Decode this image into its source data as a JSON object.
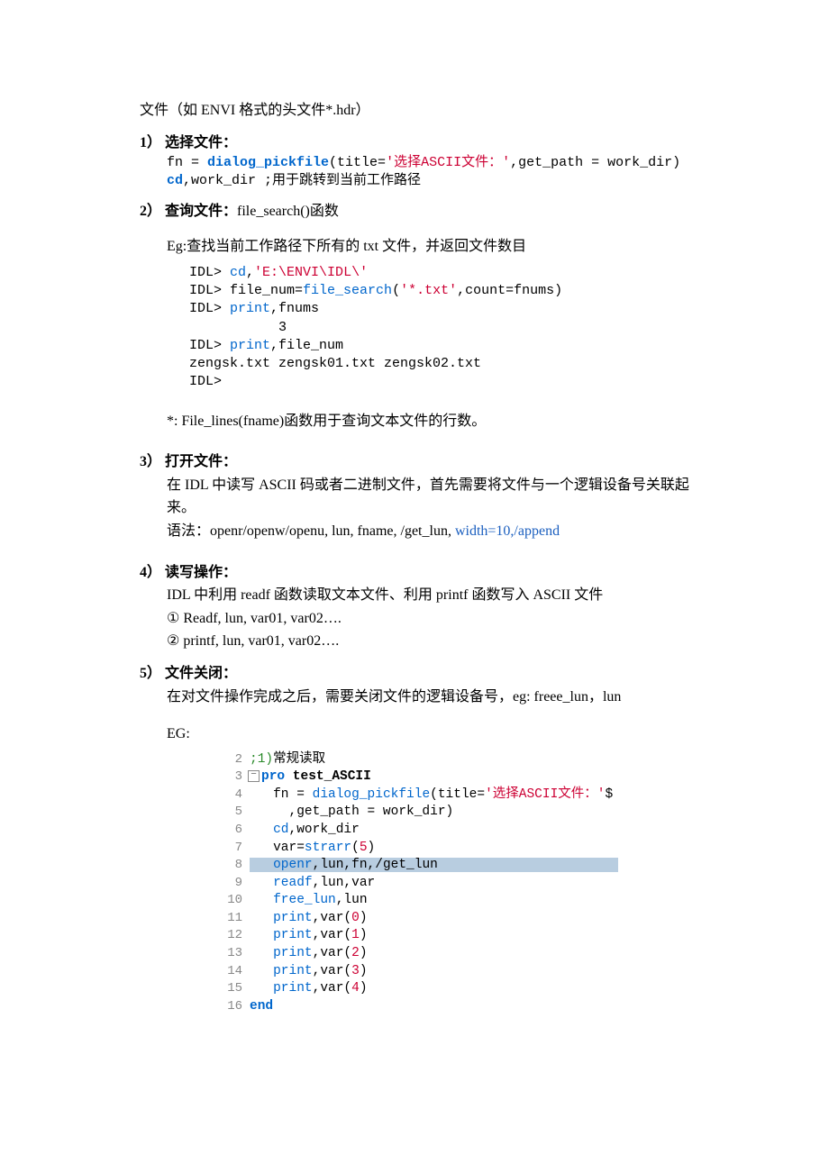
{
  "p0": "文件（如 ENVI 格式的头文件*.hdr）",
  "s1": {
    "head": "1） 选择文件：",
    "code": {
      "a1": "fn = ",
      "a2": "dialog_pickfile",
      "a3": "(title=",
      "a4": "'选择ASCII文件：'",
      "a5": ",get_path = work_dir)",
      "b1": "cd",
      "b2": ",work_dir ;用于跳转到当前工作路径"
    }
  },
  "s2": {
    "head_pre": "2） 查询文件：",
    "head_post": "file_search()函数",
    "eg": "Eg:查找当前工作路径下所有的 txt 文件，并返回文件数目",
    "code": {
      "l1a": "IDL> ",
      "l1b": "cd",
      "l1c": ",",
      "l1d": "'E:\\ENVI\\IDL\\'",
      "l2a": "IDL> ",
      "l2b": "file_num=",
      "l2c": "file_search",
      "l2d": "(",
      "l2e": "'*.txt'",
      "l2f": ",count=fnums)",
      "l3a": "IDL> ",
      "l3b": "print",
      "l3c": ",fnums",
      "l4": "           3",
      "l5a": "IDL> ",
      "l5b": "print",
      "l5c": ",file_num",
      "l6": "zengsk.txt zengsk01.txt zengsk02.txt",
      "l7": "IDL>"
    },
    "note": "*: File_lines(fname)函数用于查询文本文件的行数。"
  },
  "s3": {
    "head": "3） 打开文件：",
    "l1": "在 IDL 中读写 ASCII 码或者二进制文件，首先需要将文件与一个逻辑设备号关联起来。",
    "l2a": "语法：openr/openw/openu, lun, fname, /get_lun, ",
    "l2b": "width=10,/append"
  },
  "s4": {
    "head": "4） 读写操作：",
    "l1": "IDL 中利用 readf 函数读取文本文件、利用 printf 函数写入 ASCII 文件",
    "l2": "① Readf, lun, var01, var02….",
    "l3": "② printf, lun, var01, var02…."
  },
  "s5": {
    "head": "5） 文件关闭：",
    "l1": "在对文件操作完成之后，需要关闭文件的逻辑设备号，eg:   freee_lun，lun",
    "eg": "EG:",
    "code": {
      "r2n": "2",
      "r2a": ";1)",
      "r2b": "常规读取",
      "r3n": "3",
      "r3a": "pro",
      "r3b": " test_ASCII",
      "r4n": "4",
      "r4a": "   fn = ",
      "r4b": "dialog_pickfile",
      "r4c": "(title=",
      "r4d": "'选择ASCII文件：'",
      "r4e": "$",
      "r5n": "5",
      "r5a": "     ,get_path = work_dir)",
      "r6n": "6",
      "r6a": "   ",
      "r6b": "cd",
      "r6c": ",work_dir",
      "r7n": "7",
      "r7a": "   var=",
      "r7b": "strarr",
      "r7c": "(",
      "r7d": "5",
      "r7e": ")",
      "r8n": "8",
      "r8a": "   ",
      "r8b": "openr",
      "r8c": ",lun,fn,/get_lun",
      "r9n": "9",
      "r9a": "   ",
      "r9b": "readf",
      "r9c": ",lun,var",
      "r10n": "10",
      "r10a": "   ",
      "r10b": "free_lun",
      "r10c": ",lun",
      "r11n": "11",
      "r11a": "   ",
      "r11b": "print",
      "r11c": ",var(",
      "r11d": "0",
      "r11e": ")",
      "r12n": "12",
      "r12a": "   ",
      "r12b": "print",
      "r12c": ",var(",
      "r12d": "1",
      "r12e": ")",
      "r13n": "13",
      "r13a": "   ",
      "r13b": "print",
      "r13c": ",var(",
      "r13d": "2",
      "r13e": ")",
      "r14n": "14",
      "r14a": "   ",
      "r14b": "print",
      "r14c": ",var(",
      "r14d": "3",
      "r14e": ")",
      "r15n": "15",
      "r15a": "   ",
      "r15b": "print",
      "r15c": ",var(",
      "r15d": "4",
      "r15e": ")",
      "r16n": "16",
      "r16a": "end"
    }
  }
}
